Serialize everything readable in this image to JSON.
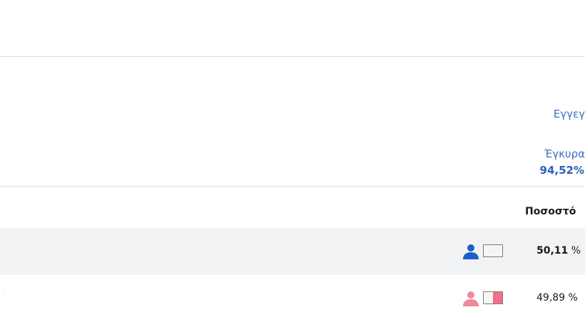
{
  "summary": {
    "registered_label": "Εγγεγ",
    "valid_label": "Έγκυρα",
    "valid_value": "94,52%"
  },
  "results": {
    "header_percentage": "Ποσοστό",
    "rows": [
      {
        "icon": "person-icon",
        "color": "#1c5fc8",
        "bar_fill": 0,
        "bar_color": "#f06f86",
        "percent": "50,11",
        "unit": "%"
      },
      {
        "icon": "person-icon",
        "color": "#f08a9b",
        "bar_fill": 0.5,
        "bar_color": "#f06f86",
        "percent": "49,89",
        "unit": "%"
      }
    ]
  }
}
